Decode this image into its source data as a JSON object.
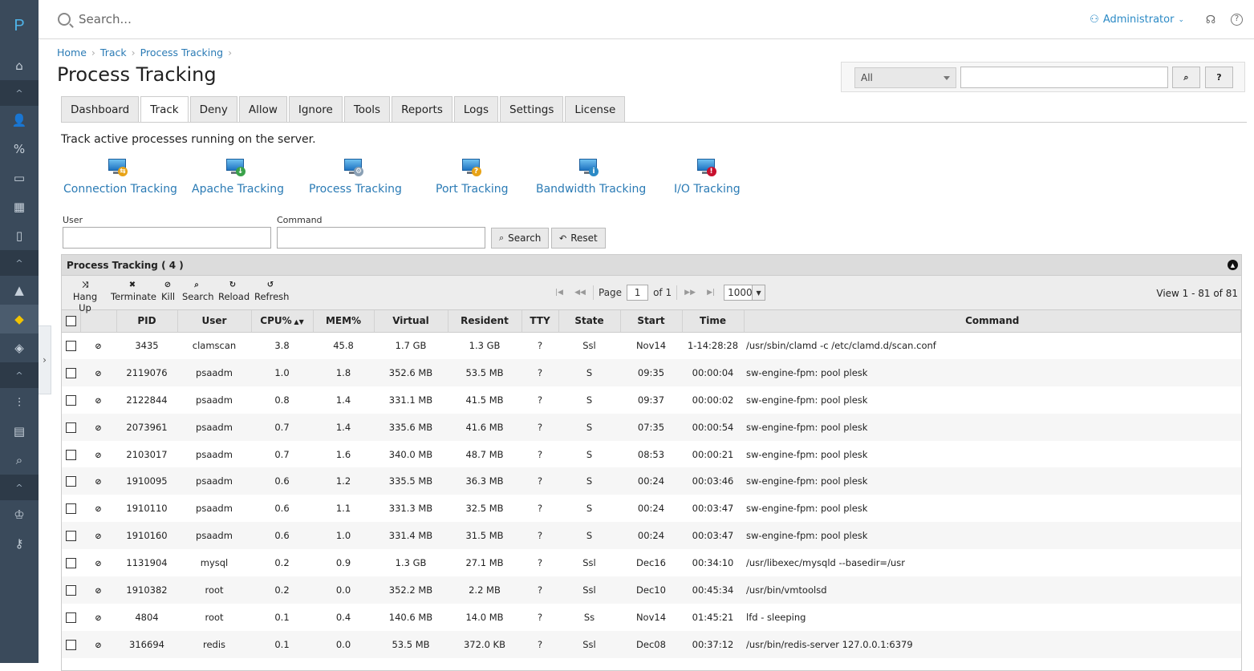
{
  "sidebar": {
    "logo": "P",
    "items": [
      {
        "name": "home-icon",
        "glyph": "⌂"
      },
      {
        "name": "collapse-up-icon",
        "glyph": "^",
        "type": "collapse"
      },
      {
        "name": "user-icon",
        "glyph": "👤"
      },
      {
        "name": "percent-icon",
        "glyph": "%"
      },
      {
        "name": "monitor-icon",
        "glyph": "▭"
      },
      {
        "name": "apps-icon",
        "glyph": "▦"
      },
      {
        "name": "book-icon",
        "glyph": "▯"
      },
      {
        "name": "collapse-up-icon",
        "glyph": "^",
        "type": "collapse"
      },
      {
        "name": "extension-icon",
        "glyph": "▲"
      },
      {
        "name": "shield-icon",
        "glyph": "◆",
        "active": true
      },
      {
        "name": "shield-secondary-icon",
        "glyph": "◈"
      },
      {
        "name": "collapse-up-icon",
        "glyph": "^",
        "type": "collapse"
      },
      {
        "name": "sliders-icon",
        "glyph": "⫶"
      },
      {
        "name": "dashboard-icon",
        "glyph": "▤"
      },
      {
        "name": "search-zoom-icon",
        "glyph": "⌕"
      },
      {
        "name": "collapse-up-icon",
        "glyph": "^",
        "type": "collapse"
      },
      {
        "name": "crown-icon",
        "glyph": "♔"
      },
      {
        "name": "key-icon",
        "glyph": "⚷"
      }
    ]
  },
  "topbar": {
    "search_placeholder": "Search...",
    "user": "Administrator"
  },
  "breadcrumb": [
    "Home",
    "Track",
    "Process Tracking"
  ],
  "page_title": "Process Tracking",
  "filter": {
    "select_value": "All",
    "search_button": "⌕",
    "help_button": "?"
  },
  "tabs": [
    "Dashboard",
    "Track",
    "Deny",
    "Allow",
    "Ignore",
    "Tools",
    "Reports",
    "Logs",
    "Settings",
    "License"
  ],
  "active_tab": "Track",
  "description": "Track active processes running on the server.",
  "trackers": [
    {
      "label": "Connection Tracking",
      "icon": "connection-tracking-icon",
      "badge": "⇆",
      "badge_color": "#e8a317"
    },
    {
      "label": "Apache Tracking",
      "icon": "apache-tracking-icon",
      "badge": "↓",
      "badge_color": "#3aa24a"
    },
    {
      "label": "Process Tracking",
      "icon": "process-tracking-icon",
      "badge": "⚙",
      "badge_color": "#8aa0b5"
    },
    {
      "label": "Port Tracking",
      "icon": "port-tracking-icon",
      "badge": "?",
      "badge_color": "#e8a317"
    },
    {
      "label": "Bandwidth Tracking",
      "icon": "bandwidth-tracking-icon",
      "badge": "i",
      "badge_color": "#2b8ac6"
    },
    {
      "label": "I/O Tracking",
      "icon": "io-tracking-icon",
      "badge": "!",
      "badge_color": "#c8102e"
    }
  ],
  "form": {
    "user_label": "User",
    "command_label": "Command",
    "search_label": "Search",
    "reset_label": "Reset"
  },
  "grid": {
    "caption": "Process Tracking ( 4 )",
    "actions": [
      {
        "label": "Hang Up",
        "icon": "⤨"
      },
      {
        "label": "Terminate",
        "icon": "✖"
      },
      {
        "label": "Kill",
        "icon": "⊘"
      },
      {
        "label": "Search",
        "icon": "⌕"
      },
      {
        "label": "Reload",
        "icon": "↻"
      },
      {
        "label": "Refresh",
        "icon": "↺"
      }
    ],
    "pager": {
      "page_label": "Page",
      "page": "1",
      "of_label": "of 1",
      "rows_per_page": "1000"
    },
    "view_info": "View 1 - 81 of 81",
    "columns": [
      "PID",
      "User",
      "CPU%",
      "MEM%",
      "Virtual",
      "Resident",
      "TTY",
      "State",
      "Start",
      "Time",
      "Command"
    ],
    "rows": [
      [
        "3435",
        "clamscan",
        "3.8",
        "45.8",
        "1.7 GB",
        "1.3 GB",
        "?",
        "Ssl",
        "Nov14",
        "1-14:28:28",
        "/usr/sbin/clamd -c /etc/clamd.d/scan.conf"
      ],
      [
        "2119076",
        "psaadm",
        "1.0",
        "1.8",
        "352.6 MB",
        "53.5 MB",
        "?",
        "S",
        "09:35",
        "00:00:04",
        "sw-engine-fpm: pool plesk"
      ],
      [
        "2122844",
        "psaadm",
        "0.8",
        "1.4",
        "331.1 MB",
        "41.5 MB",
        "?",
        "S",
        "09:37",
        "00:00:02",
        "sw-engine-fpm: pool plesk"
      ],
      [
        "2073961",
        "psaadm",
        "0.7",
        "1.4",
        "335.6 MB",
        "41.6 MB",
        "?",
        "S",
        "07:35",
        "00:00:54",
        "sw-engine-fpm: pool plesk"
      ],
      [
        "2103017",
        "psaadm",
        "0.7",
        "1.6",
        "340.0 MB",
        "48.7 MB",
        "?",
        "S",
        "08:53",
        "00:00:21",
        "sw-engine-fpm: pool plesk"
      ],
      [
        "1910095",
        "psaadm",
        "0.6",
        "1.2",
        "335.5 MB",
        "36.3 MB",
        "?",
        "S",
        "00:24",
        "00:03:46",
        "sw-engine-fpm: pool plesk"
      ],
      [
        "1910110",
        "psaadm",
        "0.6",
        "1.1",
        "331.3 MB",
        "32.5 MB",
        "?",
        "S",
        "00:24",
        "00:03:47",
        "sw-engine-fpm: pool plesk"
      ],
      [
        "1910160",
        "psaadm",
        "0.6",
        "1.0",
        "331.4 MB",
        "31.5 MB",
        "?",
        "S",
        "00:24",
        "00:03:47",
        "sw-engine-fpm: pool plesk"
      ],
      [
        "1131904",
        "mysql",
        "0.2",
        "0.9",
        "1.3 GB",
        "27.1 MB",
        "?",
        "Ssl",
        "Dec16",
        "00:34:10",
        "/usr/libexec/mysqld --basedir=/usr"
      ],
      [
        "1910382",
        "root",
        "0.2",
        "0.0",
        "352.2 MB",
        "2.2 MB",
        "?",
        "Ssl",
        "Dec10",
        "00:45:34",
        "/usr/bin/vmtoolsd"
      ],
      [
        "4804",
        "root",
        "0.1",
        "0.4",
        "140.6 MB",
        "14.0 MB",
        "?",
        "Ss",
        "Nov14",
        "01:45:21",
        "lfd - sleeping"
      ],
      [
        "316694",
        "redis",
        "0.1",
        "0.0",
        "53.5 MB",
        "372.0 KB",
        "?",
        "Ssl",
        "Dec08",
        "00:37:12",
        "/usr/bin/redis-server 127.0.0.1:6379"
      ]
    ]
  }
}
